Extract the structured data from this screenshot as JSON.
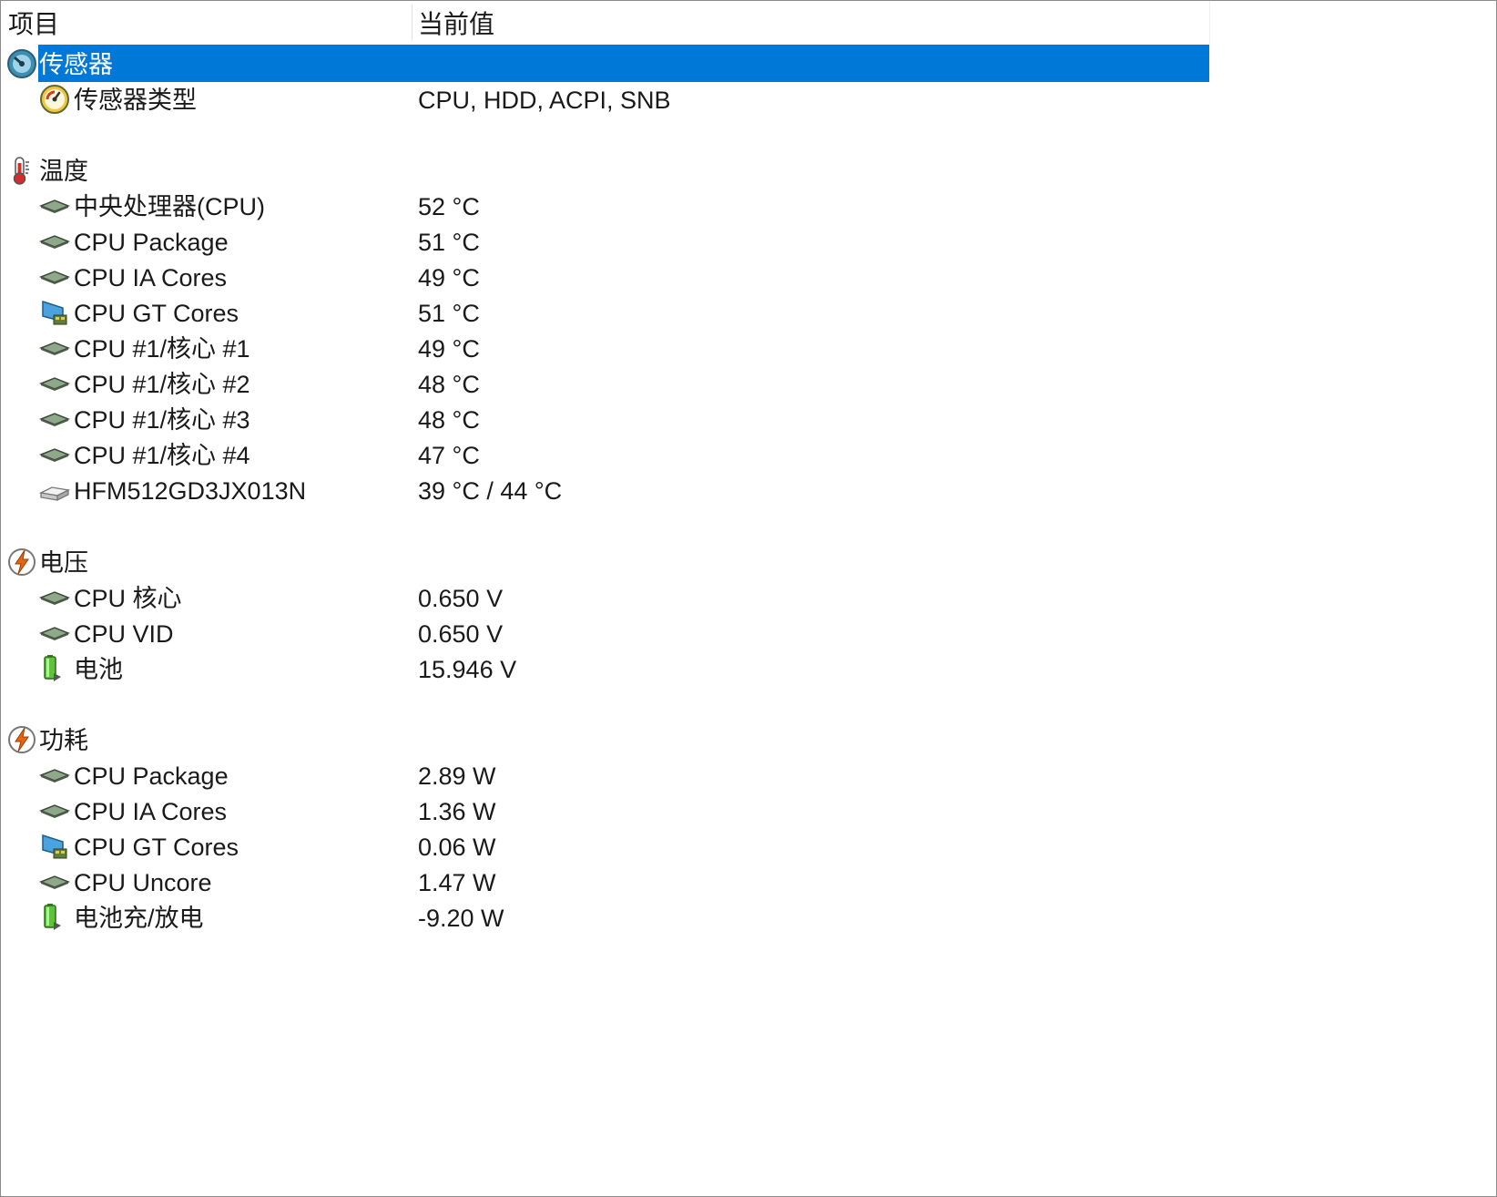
{
  "columns": {
    "item": "项目",
    "value": "当前值"
  },
  "sensor_section": {
    "label": "传感器",
    "icon": "sensor-gauge-icon",
    "selected": true,
    "selection_color": "#0078d7",
    "rows": [
      {
        "label": "传感器类型",
        "value": "CPU, HDD, ACPI, SNB",
        "icon": "gauge-meter-icon"
      }
    ]
  },
  "temperature_section": {
    "label": "温度",
    "icon": "thermometer-icon",
    "rows": [
      {
        "label": "中央处理器(CPU)",
        "value": "52 °C",
        "icon": "cpu-chip-icon"
      },
      {
        "label": "CPU Package",
        "value": "51 °C",
        "icon": "cpu-chip-icon"
      },
      {
        "label": "CPU IA Cores",
        "value": "49 °C",
        "icon": "cpu-chip-icon"
      },
      {
        "label": "CPU GT Cores",
        "value": "51 °C",
        "icon": "graphics-monitor-icon"
      },
      {
        "label": "CPU #1/核心 #1",
        "value": "49 °C",
        "icon": "cpu-chip-icon"
      },
      {
        "label": "CPU #1/核心 #2",
        "value": "48 °C",
        "icon": "cpu-chip-icon"
      },
      {
        "label": "CPU #1/核心 #3",
        "value": "48 °C",
        "icon": "cpu-chip-icon"
      },
      {
        "label": "CPU #1/核心 #4",
        "value": "47 °C",
        "icon": "cpu-chip-icon"
      },
      {
        "label": "HFM512GD3JX013N",
        "value": "39 °C / 44 °C",
        "icon": "hard-drive-icon"
      }
    ]
  },
  "voltage_section": {
    "label": "电压",
    "icon": "lightning-bolt-icon",
    "rows": [
      {
        "label": "CPU 核心",
        "value": "0.650 V",
        "icon": "cpu-chip-icon"
      },
      {
        "label": "CPU VID",
        "value": "0.650 V",
        "icon": "cpu-chip-icon"
      },
      {
        "label": "电池",
        "value": "15.946 V",
        "icon": "battery-icon"
      }
    ]
  },
  "power_section": {
    "label": "功耗",
    "icon": "lightning-bolt-icon",
    "rows": [
      {
        "label": "CPU Package",
        "value": "2.89 W",
        "icon": "cpu-chip-icon"
      },
      {
        "label": "CPU IA Cores",
        "value": "1.36 W",
        "icon": "cpu-chip-icon"
      },
      {
        "label": "CPU GT Cores",
        "value": "0.06 W",
        "icon": "graphics-monitor-icon"
      },
      {
        "label": "CPU Uncore",
        "value": "1.47 W",
        "icon": "cpu-chip-icon"
      },
      {
        "label": "电池充/放电",
        "value": "-9.20 W",
        "icon": "battery-icon"
      }
    ]
  }
}
